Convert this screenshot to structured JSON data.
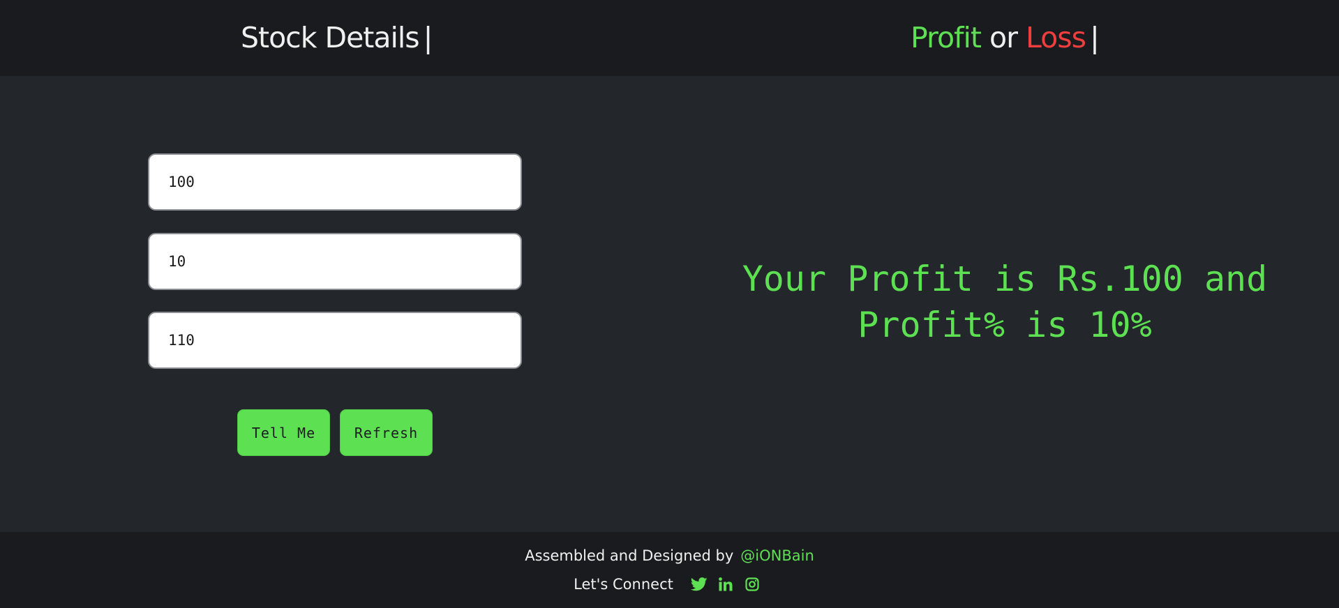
{
  "header": {
    "left_title": "Stock Details",
    "right_title_part1": "Profit",
    "right_title_part2": "or",
    "right_title_part3": "Loss",
    "separator": "|"
  },
  "form": {
    "initial_price": "100",
    "quantity": "10",
    "current_price": "110",
    "tell_me_label": "Tell Me",
    "refresh_label": "Refresh"
  },
  "result": {
    "message": "Your Profit is Rs.100 and Profit% is 10%"
  },
  "footer": {
    "credit_text": "Assembled and  Designed by",
    "credit_handle": "@iONBain",
    "connect_label": "Let's Connect",
    "social_icons": [
      "twitter-icon",
      "linkedin-icon",
      "instagram-icon"
    ]
  },
  "colors": {
    "accent_green": "#5ee053",
    "loss_red": "#ef3e3e",
    "header_bg": "#1a1b1f",
    "main_bg": "#23262b"
  }
}
